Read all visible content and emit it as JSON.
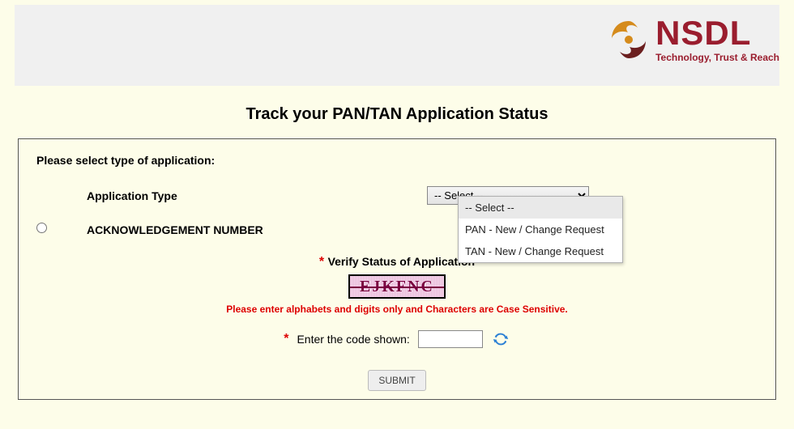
{
  "logo": {
    "name": "NSDL",
    "tagline": "Technology, Trust & Reach"
  },
  "page_title": "Track your PAN/TAN Application Status",
  "section_heading": "Please select type of application:",
  "app_type": {
    "label": "Application Type",
    "selected": "-- Select --",
    "options": [
      "-- Select --",
      "PAN - New / Change Request",
      "TAN - New / Change Request"
    ]
  },
  "ack_label": "ACKNOWLEDGEMENT NUMBER",
  "verify": {
    "heading": "Verify Status of Application",
    "captcha_value": "EJKFNC",
    "note": "Please enter alphabets and digits only and Characters are Case Sensitive.",
    "code_label": "Enter the code shown:"
  },
  "submit_label": "SUBMIT"
}
